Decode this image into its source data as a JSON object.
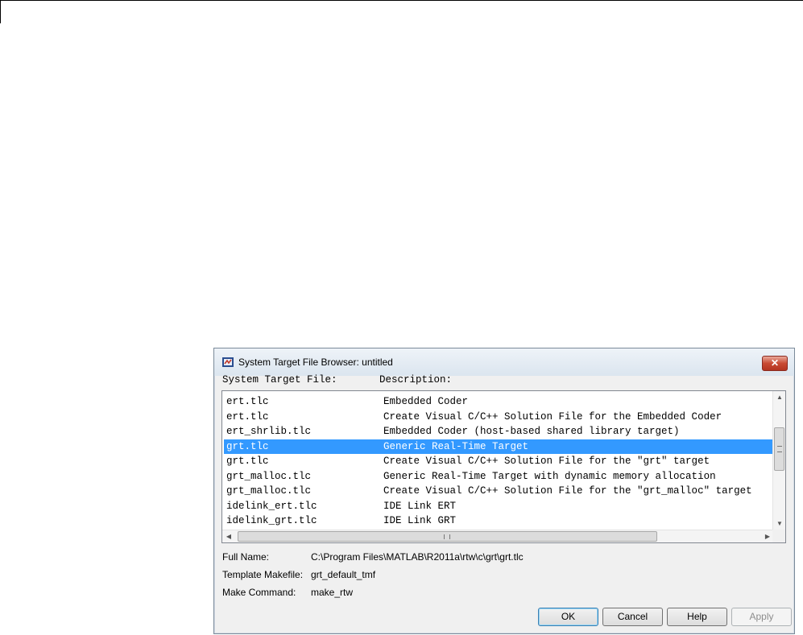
{
  "window": {
    "title": "System Target File Browser: untitled",
    "close_label": "✕"
  },
  "columns": {
    "file_header": "System Target File:",
    "desc_header": "Description:"
  },
  "targets": [
    {
      "file": "ert.tlc",
      "description": "Embedded Coder",
      "selected": false
    },
    {
      "file": "ert.tlc",
      "description": "Create Visual C/C++ Solution File for the Embedded Coder",
      "selected": false
    },
    {
      "file": "ert_shrlib.tlc",
      "description": "Embedded Coder (host-based shared library target)",
      "selected": false
    },
    {
      "file": "grt.tlc",
      "description": "Generic Real-Time Target",
      "selected": true
    },
    {
      "file": "grt.tlc",
      "description": "Create Visual C/C++ Solution File for the \"grt\" target",
      "selected": false
    },
    {
      "file": "grt_malloc.tlc",
      "description": "Generic Real-Time Target with dynamic memory allocation",
      "selected": false
    },
    {
      "file": "grt_malloc.tlc",
      "description": "Create Visual C/C++ Solution File for the \"grt_malloc\" target",
      "selected": false
    },
    {
      "file": "idelink_ert.tlc",
      "description": "IDE Link ERT",
      "selected": false
    },
    {
      "file": "idelink_grt.tlc",
      "description": "IDE Link GRT",
      "selected": false
    }
  ],
  "details": {
    "full_name_label": "Full Name:",
    "full_name_value": "C:\\Program Files\\MATLAB\\R2011a\\rtw\\c\\grt\\grt.tlc",
    "makefile_label": "Template Makefile:",
    "makefile_value": "grt_default_tmf",
    "make_command_label": "Make Command:",
    "make_command_value": "make_rtw"
  },
  "buttons": {
    "ok": "OK",
    "cancel": "Cancel",
    "help": "Help",
    "apply": "Apply"
  },
  "icons": {
    "app": "simulink-window-icon",
    "scroll_up": "▲",
    "scroll_down": "▼",
    "scroll_left": "◀",
    "scroll_right": "▶",
    "hgrip": "III"
  }
}
